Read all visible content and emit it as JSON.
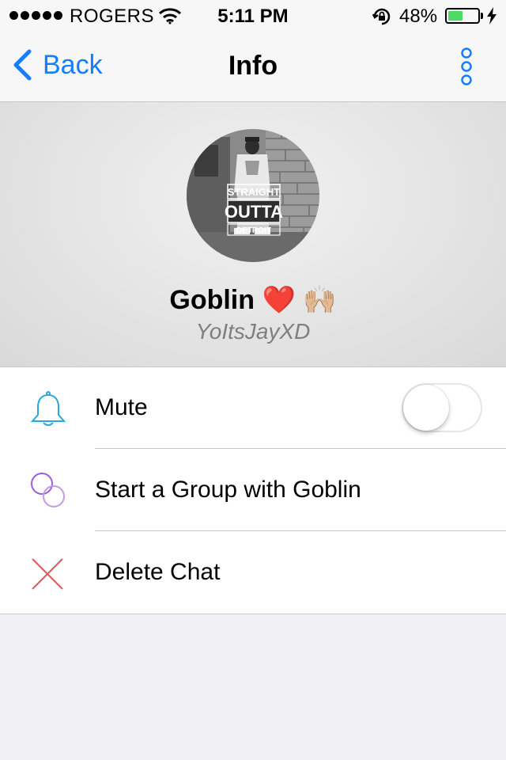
{
  "status_bar": {
    "carrier": "ROGERS",
    "time": "5:11 PM",
    "battery_percent": "48%",
    "battery_level": 0.48
  },
  "nav": {
    "back_label": "Back",
    "title": "Info",
    "more_icon": "more-vertical-dots-icon"
  },
  "profile": {
    "name": "Goblin",
    "name_emoji": "❤️ 🙌🏼",
    "username": "YoItsJayXD",
    "avatar_caption": [
      "STRAIGHT",
      "OUTTA",
      "DETROIT"
    ]
  },
  "menu": {
    "items": [
      {
        "label": "Mute",
        "icon": "bell-icon",
        "toggle_on": false
      },
      {
        "label": "Start a Group with Goblin",
        "icon": "group-circles-icon"
      },
      {
        "label": "Delete Chat",
        "icon": "x-icon"
      }
    ]
  },
  "colors": {
    "accent": "#157efb",
    "mute_icon": "#2aa7e0",
    "group_icon": "#9a5de0",
    "delete_icon": "#e05a5a",
    "battery_fill": "#4cd964"
  }
}
